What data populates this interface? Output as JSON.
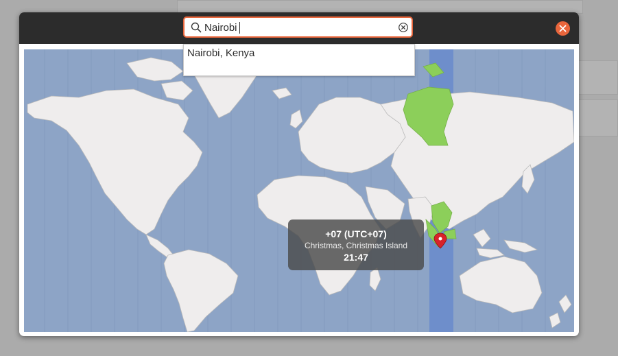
{
  "search": {
    "value": "Nairobi",
    "placeholder": ""
  },
  "results": [
    {
      "label": "Nairobi, Kenya"
    }
  ],
  "tooltip": {
    "offset": "+07 (UTC+07)",
    "location": "Christmas, Christmas Island",
    "time": "21:47"
  },
  "icons": {
    "search": "search-icon",
    "clear": "clear-icon",
    "close": "close-icon",
    "marker": "location-pin-icon"
  },
  "colors": {
    "accent": "#e9663c",
    "titlebar": "#2c2c2c",
    "ocean": "#8da4c6",
    "land": "#efeded",
    "selected_zone_band": "#6e8ecb",
    "selected_zone_land": "#8ccf5a",
    "marker": "#d8222a"
  }
}
